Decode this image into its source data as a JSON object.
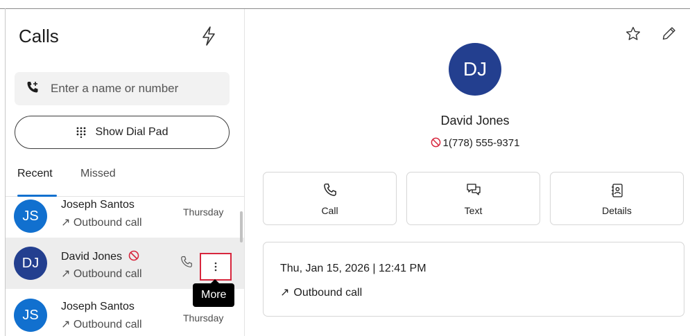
{
  "sidebar": {
    "title": "Calls",
    "search_placeholder": "Enter a name or number",
    "dialpad_label": "Show Dial Pad",
    "tabs": [
      {
        "label": "Recent",
        "active": true
      },
      {
        "label": "Missed",
        "active": false
      }
    ],
    "calls": [
      {
        "initials": "JS",
        "name": "Joseph Santos",
        "direction": "Outbound call",
        "day": "Thursday",
        "avatar_color": "#1170cf"
      },
      {
        "initials": "DJ",
        "name": "David Jones",
        "direction": "Outbound call",
        "day": "",
        "avatar_color": "#233f8f",
        "blocked": true,
        "selected": true
      },
      {
        "initials": "JS",
        "name": "Joseph Santos",
        "direction": "Outbound call",
        "day": "Thursday",
        "avatar_color": "#1170cf"
      }
    ],
    "more_tooltip": "More"
  },
  "contact": {
    "initials": "DJ",
    "name": "David Jones",
    "number": "1(778) 555-9371",
    "actions": [
      {
        "label": "Call",
        "icon": "phone-icon"
      },
      {
        "label": "Text",
        "icon": "chat-icon"
      },
      {
        "label": "Details",
        "icon": "contact-card-icon"
      }
    ],
    "history": {
      "date": "Thu, Jan 15, 2026 | 12:41 PM",
      "type": "Outbound call"
    }
  },
  "colors": {
    "accent": "#1170cf",
    "avatar_dark": "#233f8f",
    "blocked": "#d7263d",
    "highlight": "#d7263d"
  }
}
